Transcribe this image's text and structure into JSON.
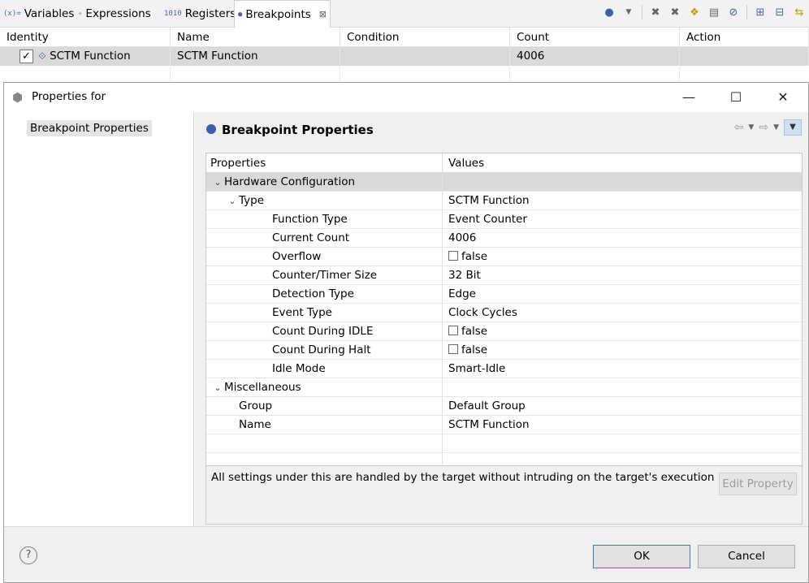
{
  "view": {
    "tabs": [
      {
        "icon": "(x)=",
        "label": "Variables"
      },
      {
        "icon": "✧",
        "label": "Expressions"
      },
      {
        "icon": "1010",
        "label": "Registers"
      },
      {
        "icon": "●",
        "label": "Breakpoints",
        "active": true
      }
    ],
    "columns": [
      "Identity",
      "Name",
      "Condition",
      "Count",
      "Action"
    ],
    "row": {
      "checked": "✓",
      "identity": "SCTM Function",
      "name": "SCTM Function",
      "condition": "",
      "count": "4006",
      "action": ""
    }
  },
  "dialog": {
    "title": "Properties for",
    "nav_item": "Breakpoint Properties",
    "page_title": "Breakpoint Properties",
    "columns": [
      "Properties",
      "Values"
    ],
    "rows": [
      {
        "level": 0,
        "expander": "⌄",
        "label": "Hardware Configuration",
        "value": "",
        "selected": true
      },
      {
        "level": 1,
        "expander": "⌄",
        "label": "Type",
        "value": "SCTM Function"
      },
      {
        "level": 2,
        "label": "Function Type",
        "value": "Event Counter"
      },
      {
        "level": 2,
        "label": "Current Count",
        "value": "4006"
      },
      {
        "level": 2,
        "label": "Overflow",
        "value": "false",
        "checkbox": true
      },
      {
        "level": 2,
        "label": "Counter/Timer Size",
        "value": "32 Bit"
      },
      {
        "level": 2,
        "label": "Detection Type",
        "value": "Edge"
      },
      {
        "level": 2,
        "label": "Event Type",
        "value": "Clock Cycles"
      },
      {
        "level": 2,
        "label": "Count During IDLE",
        "value": "false",
        "checkbox": true
      },
      {
        "level": 2,
        "label": "Count During Halt",
        "value": "false",
        "checkbox": true
      },
      {
        "level": 2,
        "label": "Idle Mode",
        "value": "Smart-Idle"
      },
      {
        "level": 0,
        "expander": "⌄",
        "label": "Miscellaneous",
        "value": ""
      },
      {
        "level": 1,
        "label": "Group",
        "value": "Default Group"
      },
      {
        "level": 1,
        "label": "Name",
        "value": "SCTM Function"
      }
    ],
    "description": "All settings under this are handled by the target without intruding on the target's execution",
    "edit_property_label": "Edit Property",
    "ok_label": "OK",
    "cancel_label": "Cancel",
    "help_glyph": "?"
  }
}
